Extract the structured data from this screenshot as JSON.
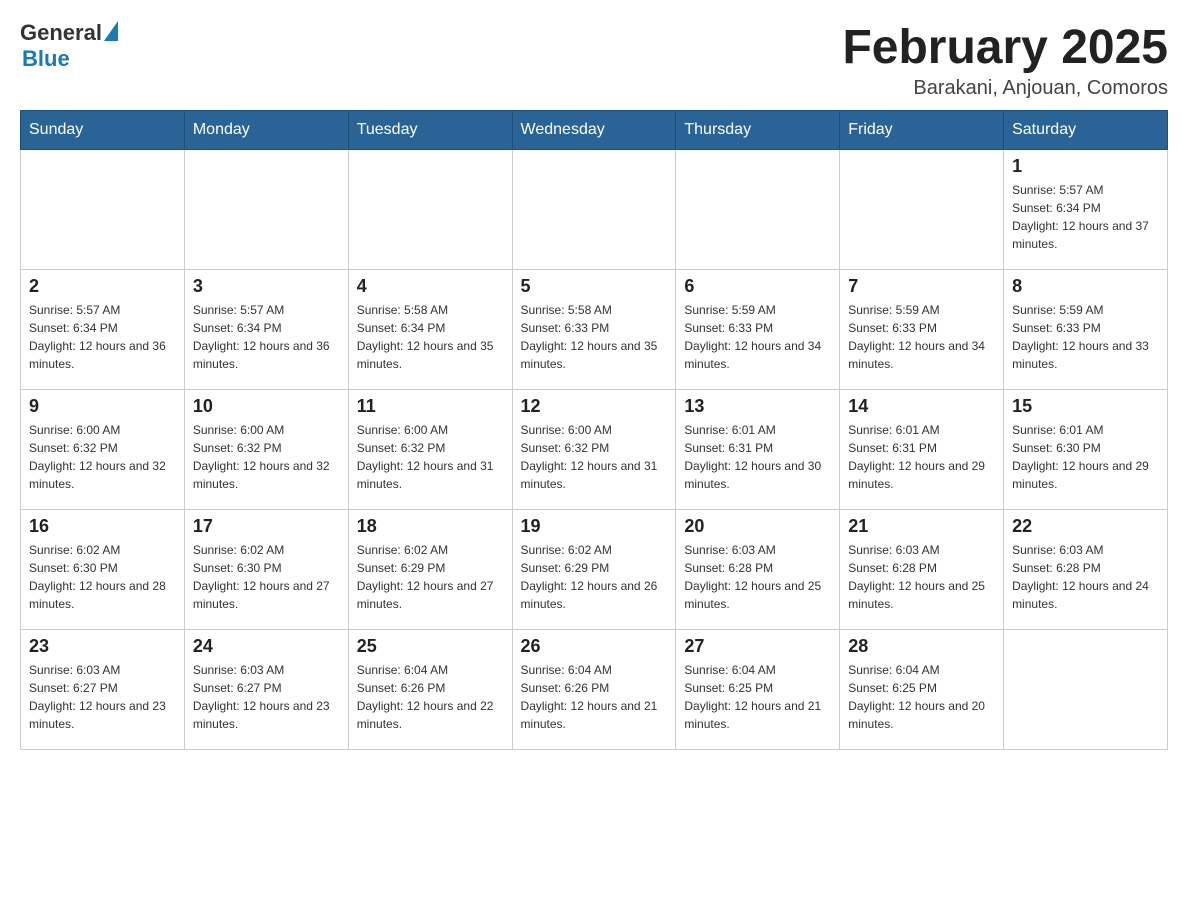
{
  "header": {
    "logo_general": "General",
    "logo_blue": "Blue",
    "month_title": "February 2025",
    "location": "Barakani, Anjouan, Comoros"
  },
  "weekdays": [
    "Sunday",
    "Monday",
    "Tuesday",
    "Wednesday",
    "Thursday",
    "Friday",
    "Saturday"
  ],
  "weeks": [
    [
      {
        "day": "",
        "info": ""
      },
      {
        "day": "",
        "info": ""
      },
      {
        "day": "",
        "info": ""
      },
      {
        "day": "",
        "info": ""
      },
      {
        "day": "",
        "info": ""
      },
      {
        "day": "",
        "info": ""
      },
      {
        "day": "1",
        "info": "Sunrise: 5:57 AM\nSunset: 6:34 PM\nDaylight: 12 hours and 37 minutes."
      }
    ],
    [
      {
        "day": "2",
        "info": "Sunrise: 5:57 AM\nSunset: 6:34 PM\nDaylight: 12 hours and 36 minutes."
      },
      {
        "day": "3",
        "info": "Sunrise: 5:57 AM\nSunset: 6:34 PM\nDaylight: 12 hours and 36 minutes."
      },
      {
        "day": "4",
        "info": "Sunrise: 5:58 AM\nSunset: 6:34 PM\nDaylight: 12 hours and 35 minutes."
      },
      {
        "day": "5",
        "info": "Sunrise: 5:58 AM\nSunset: 6:33 PM\nDaylight: 12 hours and 35 minutes."
      },
      {
        "day": "6",
        "info": "Sunrise: 5:59 AM\nSunset: 6:33 PM\nDaylight: 12 hours and 34 minutes."
      },
      {
        "day": "7",
        "info": "Sunrise: 5:59 AM\nSunset: 6:33 PM\nDaylight: 12 hours and 34 minutes."
      },
      {
        "day": "8",
        "info": "Sunrise: 5:59 AM\nSunset: 6:33 PM\nDaylight: 12 hours and 33 minutes."
      }
    ],
    [
      {
        "day": "9",
        "info": "Sunrise: 6:00 AM\nSunset: 6:32 PM\nDaylight: 12 hours and 32 minutes."
      },
      {
        "day": "10",
        "info": "Sunrise: 6:00 AM\nSunset: 6:32 PM\nDaylight: 12 hours and 32 minutes."
      },
      {
        "day": "11",
        "info": "Sunrise: 6:00 AM\nSunset: 6:32 PM\nDaylight: 12 hours and 31 minutes."
      },
      {
        "day": "12",
        "info": "Sunrise: 6:00 AM\nSunset: 6:32 PM\nDaylight: 12 hours and 31 minutes."
      },
      {
        "day": "13",
        "info": "Sunrise: 6:01 AM\nSunset: 6:31 PM\nDaylight: 12 hours and 30 minutes."
      },
      {
        "day": "14",
        "info": "Sunrise: 6:01 AM\nSunset: 6:31 PM\nDaylight: 12 hours and 29 minutes."
      },
      {
        "day": "15",
        "info": "Sunrise: 6:01 AM\nSunset: 6:30 PM\nDaylight: 12 hours and 29 minutes."
      }
    ],
    [
      {
        "day": "16",
        "info": "Sunrise: 6:02 AM\nSunset: 6:30 PM\nDaylight: 12 hours and 28 minutes."
      },
      {
        "day": "17",
        "info": "Sunrise: 6:02 AM\nSunset: 6:30 PM\nDaylight: 12 hours and 27 minutes."
      },
      {
        "day": "18",
        "info": "Sunrise: 6:02 AM\nSunset: 6:29 PM\nDaylight: 12 hours and 27 minutes."
      },
      {
        "day": "19",
        "info": "Sunrise: 6:02 AM\nSunset: 6:29 PM\nDaylight: 12 hours and 26 minutes."
      },
      {
        "day": "20",
        "info": "Sunrise: 6:03 AM\nSunset: 6:28 PM\nDaylight: 12 hours and 25 minutes."
      },
      {
        "day": "21",
        "info": "Sunrise: 6:03 AM\nSunset: 6:28 PM\nDaylight: 12 hours and 25 minutes."
      },
      {
        "day": "22",
        "info": "Sunrise: 6:03 AM\nSunset: 6:28 PM\nDaylight: 12 hours and 24 minutes."
      }
    ],
    [
      {
        "day": "23",
        "info": "Sunrise: 6:03 AM\nSunset: 6:27 PM\nDaylight: 12 hours and 23 minutes."
      },
      {
        "day": "24",
        "info": "Sunrise: 6:03 AM\nSunset: 6:27 PM\nDaylight: 12 hours and 23 minutes."
      },
      {
        "day": "25",
        "info": "Sunrise: 6:04 AM\nSunset: 6:26 PM\nDaylight: 12 hours and 22 minutes."
      },
      {
        "day": "26",
        "info": "Sunrise: 6:04 AM\nSunset: 6:26 PM\nDaylight: 12 hours and 21 minutes."
      },
      {
        "day": "27",
        "info": "Sunrise: 6:04 AM\nSunset: 6:25 PM\nDaylight: 12 hours and 21 minutes."
      },
      {
        "day": "28",
        "info": "Sunrise: 6:04 AM\nSunset: 6:25 PM\nDaylight: 12 hours and 20 minutes."
      },
      {
        "day": "",
        "info": ""
      }
    ]
  ]
}
